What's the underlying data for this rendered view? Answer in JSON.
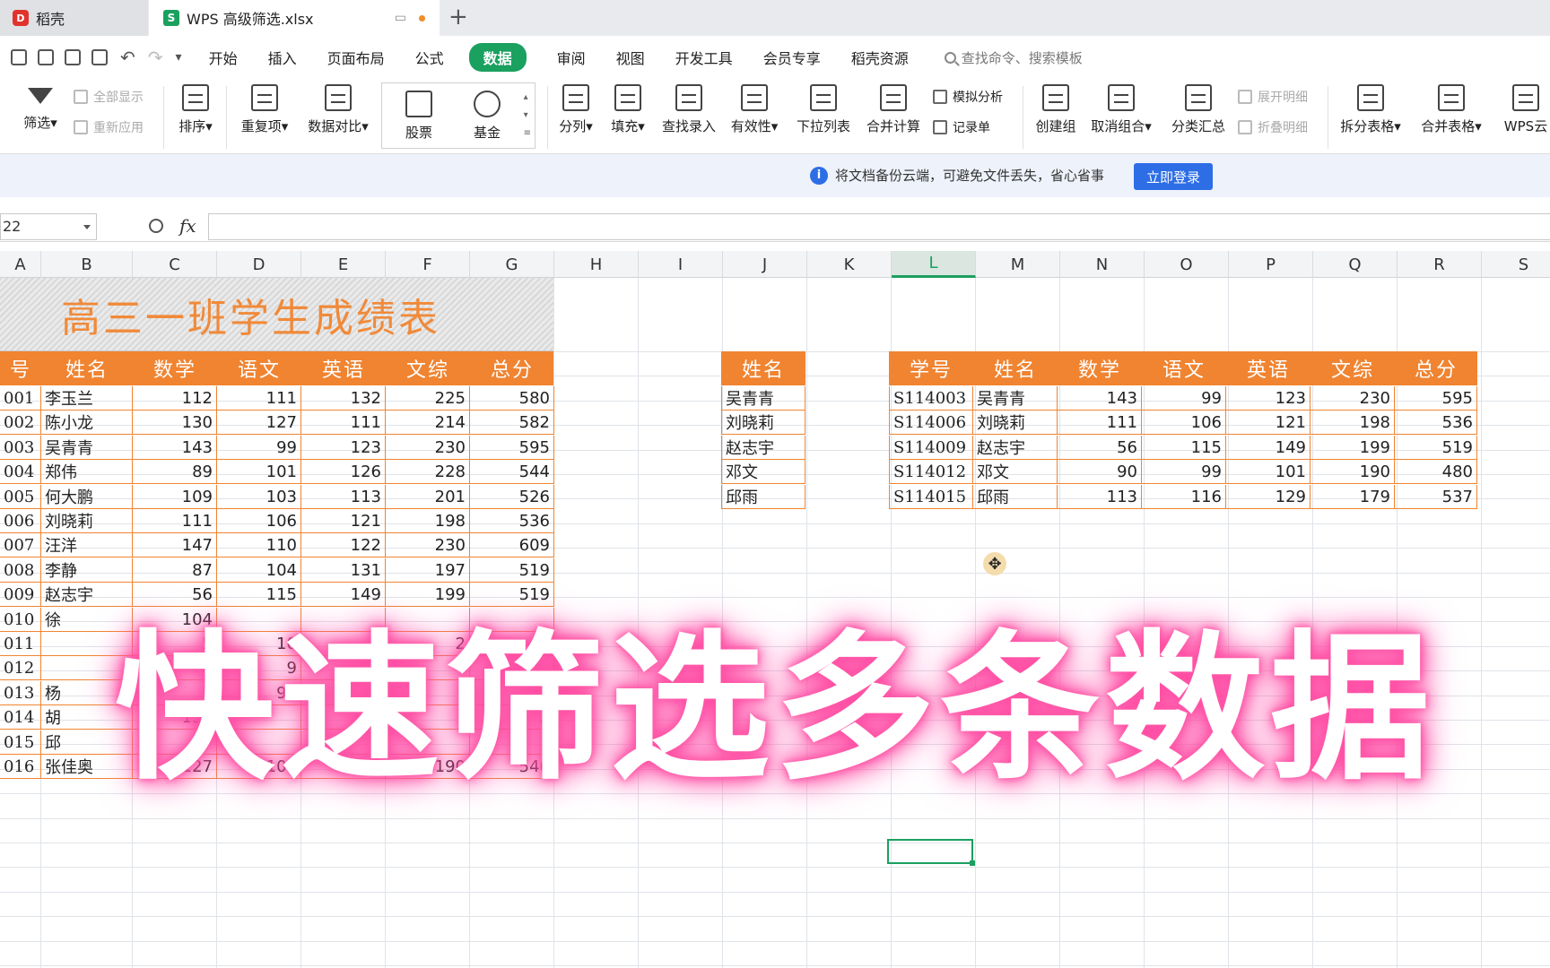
{
  "tabs": {
    "home": "稻壳",
    "doc": "WPS 高级筛选.xlsx",
    "home_icon": "docer-logo-icon",
    "doc_icon": "wps-spreadsheet-icon"
  },
  "menu": [
    "开始",
    "插入",
    "页面布局",
    "公式",
    "数据",
    "审阅",
    "视图",
    "开发工具",
    "会员专享",
    "稻壳资源"
  ],
  "active_menu": "数据",
  "search_placeholder": "查找命令、搜索模板",
  "ribbon": {
    "filter": "筛选",
    "show_all": "全部显示",
    "reapply": "重新应用",
    "sort": "排序",
    "duplicates": "重复项",
    "compare": "数据对比",
    "stock": "股票",
    "fund": "基金",
    "split": "分列",
    "fill": "填充",
    "lookup": "查找录入",
    "validity": "有效性",
    "dropdown": "下拉列表",
    "consolidate": "合并计算",
    "what_if": "模拟分析",
    "record": "记录单",
    "group": "创建组",
    "ungroup": "取消组合",
    "subtotal": "分类汇总",
    "expand": "展开明细",
    "collapse": "折叠明细",
    "split_table": "拆分表格",
    "merge_table": "合并表格",
    "wps_cloud": "WPS云"
  },
  "notice": {
    "text": "将文档备份云端，可避免文件丢失，省心省事",
    "button": "立即登录"
  },
  "formula_bar": {
    "name_box": "22",
    "fx": "fx",
    "value": ""
  },
  "columns": [
    "A",
    "B",
    "C",
    "D",
    "E",
    "F",
    "G",
    "H",
    "I",
    "J",
    "K",
    "L",
    "M",
    "N",
    "O",
    "P",
    "Q",
    "R",
    "S"
  ],
  "selected_column": "L",
  "title": "高三一班学生成绩表",
  "main_table": {
    "headers": [
      "号",
      "姓名",
      "数学",
      "语文",
      "英语",
      "文综",
      "总分"
    ],
    "rows": [
      [
        "001",
        "李玉兰",
        "112",
        "111",
        "132",
        "225",
        "580"
      ],
      [
        "002",
        "陈小龙",
        "130",
        "127",
        "111",
        "214",
        "582"
      ],
      [
        "003",
        "吴青青",
        "143",
        "99",
        "123",
        "230",
        "595"
      ],
      [
        "004",
        "郑伟",
        "89",
        "101",
        "126",
        "228",
        "544"
      ],
      [
        "005",
        "何大鹏",
        "109",
        "103",
        "113",
        "201",
        "526"
      ],
      [
        "006",
        "刘晓莉",
        "111",
        "106",
        "121",
        "198",
        "536"
      ],
      [
        "007",
        "汪洋",
        "147",
        "110",
        "122",
        "230",
        "609"
      ],
      [
        "008",
        "李静",
        "87",
        "104",
        "131",
        "197",
        "519"
      ],
      [
        "009",
        "赵志宇",
        "56",
        "115",
        "149",
        "199",
        "519"
      ],
      [
        "010",
        "徐",
        "104",
        "",
        "",
        "",
        ""
      ],
      [
        "011",
        "",
        "5",
        "10",
        "",
        "2",
        ""
      ],
      [
        "012",
        "",
        "0",
        "9",
        "",
        "",
        ""
      ],
      [
        "013",
        "杨",
        "",
        "97",
        "",
        "",
        ""
      ],
      [
        "014",
        "胡",
        "139",
        "",
        "12",
        "",
        "2"
      ],
      [
        "015",
        "邱",
        "",
        "",
        "",
        "",
        ""
      ],
      [
        "016",
        "张佳奥",
        "127",
        "107",
        "118",
        "190",
        "540"
      ]
    ]
  },
  "criteria_table": {
    "header": "姓名",
    "rows": [
      "吴青青",
      "刘晓莉",
      "赵志宇",
      "邓文",
      "邱雨"
    ]
  },
  "result_table": {
    "headers": [
      "学号",
      "姓名",
      "数学",
      "语文",
      "英语",
      "文综",
      "总分"
    ],
    "rows": [
      [
        "S114003",
        "吴青青",
        "143",
        "99",
        "123",
        "230",
        "595"
      ],
      [
        "S114006",
        "刘晓莉",
        "111",
        "106",
        "121",
        "198",
        "536"
      ],
      [
        "S114009",
        "赵志宇",
        "56",
        "115",
        "149",
        "199",
        "519"
      ],
      [
        "S114012",
        "邓文",
        "90",
        "99",
        "101",
        "190",
        "480"
      ],
      [
        "S114015",
        "邱雨",
        "113",
        "116",
        "129",
        "179",
        "537"
      ]
    ]
  },
  "overlay_text": "快速筛选多条数据",
  "colors": {
    "accent_green": "#1aa05f",
    "header_orange": "#f08431",
    "title_orange": "#f08a3a",
    "overlay_glow": "#ff4aa0",
    "login_blue": "#2d6ee6"
  }
}
